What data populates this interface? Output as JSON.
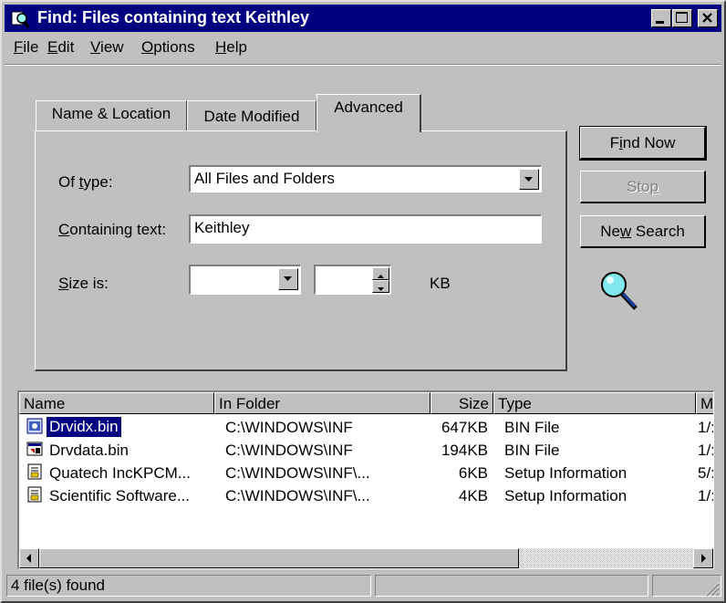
{
  "window": {
    "title": "Find: Files containing text Keithley",
    "controls": [
      "minimize-icon",
      "maximize-icon",
      "close-icon"
    ]
  },
  "menu": [
    {
      "pre": "",
      "key": "F",
      "post": "ile"
    },
    {
      "pre": "",
      "key": "E",
      "post": "dit"
    },
    {
      "pre": "",
      "key": "V",
      "post": "iew"
    },
    {
      "pre": "",
      "key": "O",
      "post": "ptions"
    },
    {
      "pre": "",
      "key": "H",
      "post": "elp"
    }
  ],
  "tabs": [
    {
      "label": "Name & Location"
    },
    {
      "label": "Date Modified"
    },
    {
      "label": "Advanced"
    }
  ],
  "advanced": {
    "of_type_label": {
      "pre": "Of ",
      "key": "t",
      "post": "ype:"
    },
    "of_type_value": "All Files and Folders",
    "containing_label": {
      "pre": "",
      "key": "C",
      "post": "ontaining text:"
    },
    "containing_value": "Keithley",
    "size_label": {
      "pre": "",
      "key": "S",
      "post": "ize is:"
    },
    "size_unit": "KB"
  },
  "buttons": {
    "find_now": {
      "pre": "F",
      "key": "i",
      "post": "nd Now"
    },
    "stop": {
      "pre": "Sto",
      "key": "p",
      "post": ""
    },
    "new_search": {
      "pre": "Ne",
      "key": "w",
      "post": " Search"
    }
  },
  "list": {
    "columns": [
      "Name",
      "In Folder",
      "Size",
      "Type",
      "Mc"
    ],
    "rows": [
      {
        "name": "Drvidx.bin",
        "folder": "C:\\WINDOWS\\INF",
        "size": "647KB",
        "type": "BIN File",
        "modified": "1/:",
        "icon": "bin-file-icon",
        "selected": true
      },
      {
        "name": "Drvdata.bin",
        "folder": "C:\\WINDOWS\\INF",
        "size": "194KB",
        "type": "BIN File",
        "modified": "1/:",
        "icon": "bin-file-icon",
        "selected": false
      },
      {
        "name": "Quatech IncKPCM...",
        "folder": "C:\\WINDOWS\\INF\\...",
        "size": "6KB",
        "type": "Setup Information",
        "modified": "5/:",
        "icon": "setup-file-icon",
        "selected": false
      },
      {
        "name": "Scientific Software...",
        "folder": "C:\\WINDOWS\\INF\\...",
        "size": "4KB",
        "type": "Setup Information",
        "modified": "1/:",
        "icon": "setup-file-icon",
        "selected": false
      }
    ]
  },
  "status": {
    "count_text": "4 file(s) found"
  },
  "colors": {
    "titlebar": "#000080",
    "face": "#c0c0c0",
    "selection": "#000080"
  }
}
